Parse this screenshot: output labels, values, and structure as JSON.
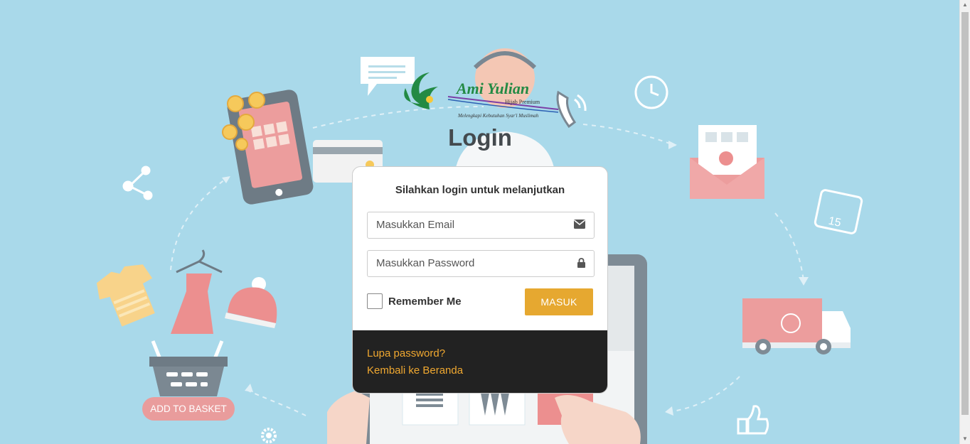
{
  "page": {
    "title": "Login",
    "logo_text": "Ami Yulian",
    "logo_sub": "Hijab Premium",
    "logo_tagline": "Melengkapi Kebutuhan Syar'i Muslimah"
  },
  "form": {
    "heading": "Silahkan login untuk melanjutkan",
    "email_placeholder": "Masukkan Email",
    "password_placeholder": "Masukkan Password",
    "remember_label": "Remember Me",
    "submit_label": "MASUK"
  },
  "footer_links": {
    "forgot": "Lupa password?",
    "home": "Kembali ke Beranda"
  },
  "background": {
    "basket_button": "ADD TO BASKET",
    "calendar_day": "15"
  },
  "colors": {
    "background": "#a9d9ea",
    "accent": "#e6a830",
    "link": "#f0a830",
    "footer": "#222222",
    "pink": "#e99c9c"
  }
}
